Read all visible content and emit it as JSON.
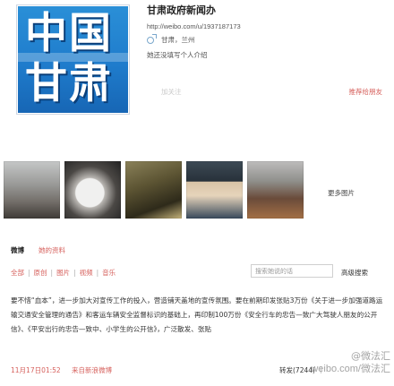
{
  "profile": {
    "avatar_text": "中国甘肃",
    "name": "甘肃政府新闻办",
    "url": "http://weibo.com/u/1937187173",
    "location": "甘肃，兰州",
    "bio": "她还没填写个人介绍",
    "follow_label": "加关注",
    "recommend_label": "推荐给朋友"
  },
  "photos": {
    "more_label": "更多图片"
  },
  "tabs": [
    {
      "label": "微博"
    },
    {
      "label": "她的资料"
    }
  ],
  "filters": {
    "items": [
      "全部",
      "原创",
      "图片",
      "视频",
      "音乐"
    ],
    "separator": "|"
  },
  "search": {
    "placeholder": "搜索她说的话",
    "advanced_label": "高级搜索"
  },
  "post": {
    "text": "要不惜“血本”，进一步加大对宣传工作的投入，营造铺天盖地的宣传氛围。要在前期印发张贴3万份《关于进一步加强道路运输交通安全管理的通告》和客运车辆安全监督标识的基础上，再印制100万份《安全行车的忠告—致广大驾驶人朋友的公开信》、《平安出行的忠告—致中、小学生的公开信》，广泛散发、张贴",
    "time": "11月17日01:52",
    "source": "来自新浪微博",
    "repost": "转发(7244)",
    "pipe": "|"
  },
  "watermark": {
    "brand": "@微法汇",
    "url": "weibo.com/微法汇"
  }
}
